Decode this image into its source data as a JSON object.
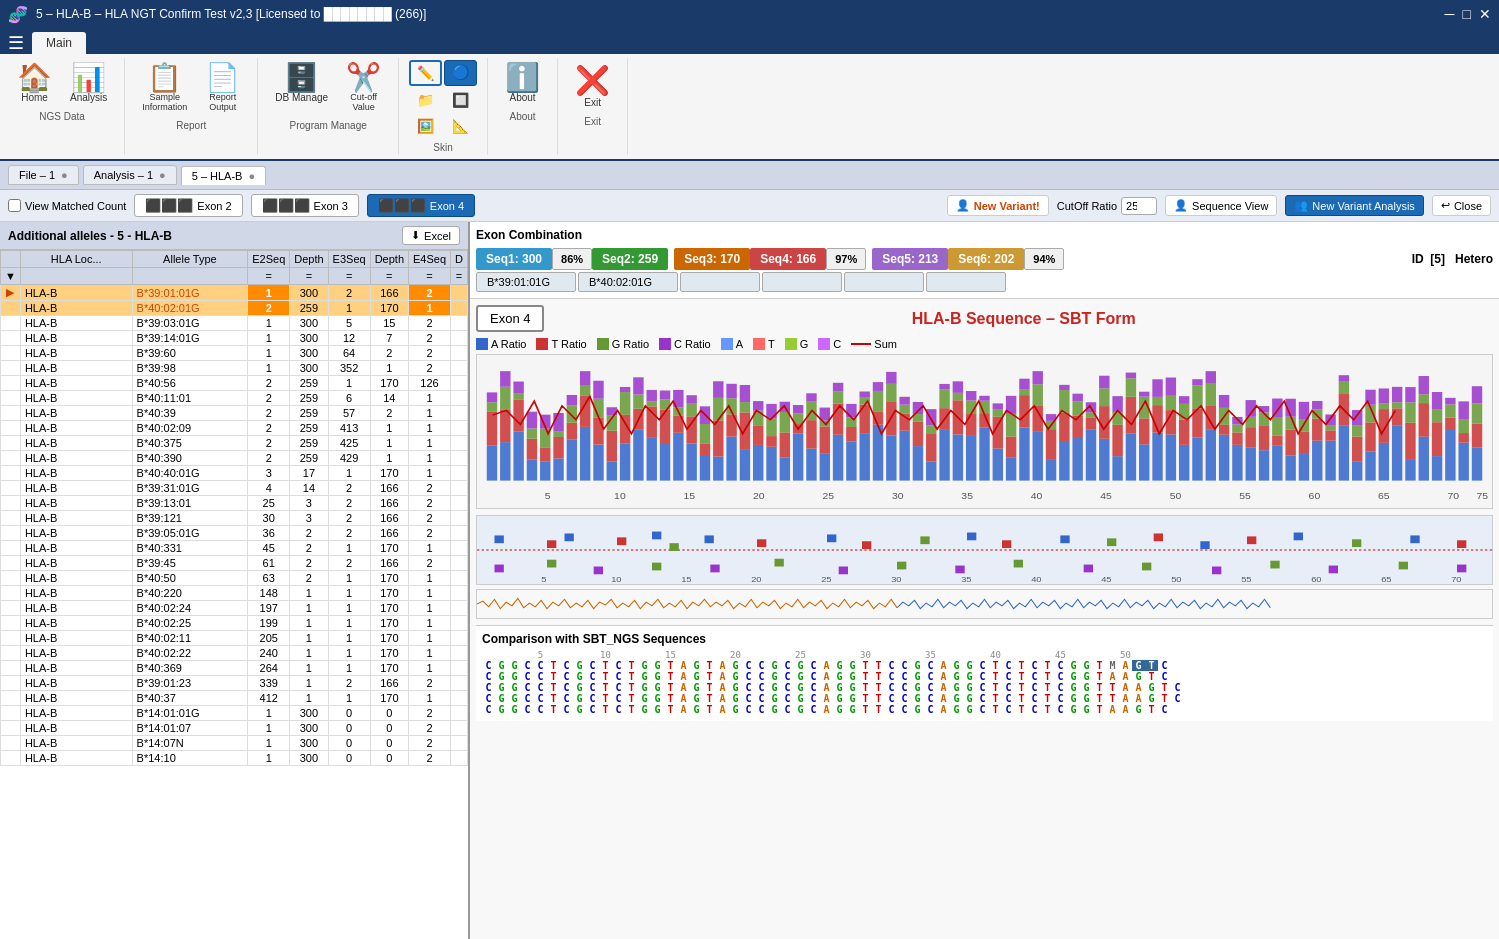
{
  "titleBar": {
    "title": "5 – HLA-B – HLA NGT Confirm Test v2,3  [Licensed to ████████ (266)]",
    "controls": [
      "minimize",
      "maximize",
      "close"
    ]
  },
  "ribbon": {
    "tabs": [
      "Main"
    ],
    "activeTab": "Main",
    "groups": [
      {
        "label": "NGS Data",
        "buttons": [
          {
            "icon": "🏠",
            "label": "Home"
          },
          {
            "icon": "📊",
            "label": "Analysis"
          }
        ]
      },
      {
        "label": "Report",
        "buttons": [
          {
            "icon": "📋",
            "label": "Sample\nInformation"
          },
          {
            "icon": "📄",
            "label": "Report\nOutput"
          }
        ]
      },
      {
        "label": "Program Manage",
        "buttons": [
          {
            "icon": "🗄️",
            "label": "DB Manage"
          },
          {
            "icon": "✂️",
            "label": "Cut-off\nValue"
          }
        ]
      },
      {
        "label": "Skin",
        "buttons": [
          {
            "icon": "🎨",
            "label": ""
          },
          {
            "icon": "🔵",
            "label": ""
          },
          {
            "icon": "📁",
            "label": ""
          },
          {
            "icon": "🔲",
            "label": ""
          }
        ]
      },
      {
        "label": "About",
        "buttons": [
          {
            "icon": "ℹ️",
            "label": "About"
          }
        ]
      },
      {
        "label": "Exit",
        "buttons": [
          {
            "icon": "❌",
            "label": "Exit"
          }
        ]
      }
    ]
  },
  "docTabs": [
    {
      "label": "File – 1",
      "active": false
    },
    {
      "label": "Analysis – 1",
      "active": false
    },
    {
      "label": "5 – HLA-B",
      "active": true
    }
  ],
  "toolbar": {
    "viewMatchedCount": "View Matched Count",
    "exonTabs": [
      "Exon 2",
      "Exon 3",
      "Exon 4"
    ],
    "activeExon": "Exon 4",
    "newVariantLabel": "New Variant!",
    "cutOffRatioLabel": "CutOff Ratio",
    "cutOffValue": "25",
    "sequenceViewLabel": "Sequence View",
    "newVariantAnalysisLabel": "New Variant Analysis",
    "closeLabel": "Close"
  },
  "leftPanel": {
    "header": "Additional alleles - 5 - HLA-B",
    "excelBtn": "Excel",
    "columns": [
      "HLA Loc...",
      "Allele Type",
      "E2Seq",
      "Depth",
      "E3Seq",
      "Depth",
      "E4Seq",
      "D"
    ],
    "rows": [
      {
        "hlb": "HLA-B",
        "allele": "B*39:01:01G",
        "e2seq": "1",
        "e2dep": "300",
        "e3seq": "2",
        "e3dep": "166",
        "e4seq": "2",
        "d": "",
        "selected": true,
        "rank": "1"
      },
      {
        "hlb": "HLA-B",
        "allele": "B*40:02:01G",
        "e2seq": "2",
        "e2dep": "259",
        "e3seq": "1",
        "e3dep": "170",
        "e4seq": "1",
        "d": "",
        "selected": true,
        "rank": "2"
      },
      {
        "hlb": "HLA-B",
        "allele": "B*39:03:01G",
        "e2seq": "1",
        "e2dep": "300",
        "e3seq": "5",
        "e3dep": "15",
        "e4seq": "2",
        "d": ""
      },
      {
        "hlb": "HLA-B",
        "allele": "B*39:14:01G",
        "e2seq": "1",
        "e2dep": "300",
        "e3seq": "12",
        "e3dep": "7",
        "e4seq": "2",
        "d": ""
      },
      {
        "hlb": "HLA-B",
        "allele": "B*39:60",
        "e2seq": "1",
        "e2dep": "300",
        "e3seq": "64",
        "e3dep": "2",
        "e4seq": "2",
        "d": ""
      },
      {
        "hlb": "HLA-B",
        "allele": "B*39:98",
        "e2seq": "1",
        "e2dep": "300",
        "e3seq": "352",
        "e3dep": "1",
        "e4seq": "2",
        "d": ""
      },
      {
        "hlb": "HLA-B",
        "allele": "B*40:56",
        "e2seq": "2",
        "e2dep": "259",
        "e3seq": "1",
        "e3dep": "170",
        "e4seq": "126",
        "d": ""
      },
      {
        "hlb": "HLA-B",
        "allele": "B*40:11:01",
        "e2seq": "2",
        "e2dep": "259",
        "e3seq": "6",
        "e3dep": "14",
        "e4seq": "1",
        "d": ""
      },
      {
        "hlb": "HLA-B",
        "allele": "B*40:39",
        "e2seq": "2",
        "e2dep": "259",
        "e3seq": "57",
        "e3dep": "2",
        "e4seq": "1",
        "d": ""
      },
      {
        "hlb": "HLA-B",
        "allele": "B*40:02:09",
        "e2seq": "2",
        "e2dep": "259",
        "e3seq": "413",
        "e3dep": "1",
        "e4seq": "1",
        "d": ""
      },
      {
        "hlb": "HLA-B",
        "allele": "B*40:375",
        "e2seq": "2",
        "e2dep": "259",
        "e3seq": "425",
        "e3dep": "1",
        "e4seq": "1",
        "d": ""
      },
      {
        "hlb": "HLA-B",
        "allele": "B*40:390",
        "e2seq": "2",
        "e2dep": "259",
        "e3seq": "429",
        "e3dep": "1",
        "e4seq": "1",
        "d": ""
      },
      {
        "hlb": "HLA-B",
        "allele": "B*40:40:01G",
        "e2seq": "3",
        "e2dep": "17",
        "e3seq": "1",
        "e3dep": "170",
        "e4seq": "1",
        "d": ""
      },
      {
        "hlb": "HLA-B",
        "allele": "B*39:31:01G",
        "e2seq": "4",
        "e2dep": "14",
        "e3seq": "2",
        "e3dep": "166",
        "e4seq": "2",
        "d": ""
      },
      {
        "hlb": "HLA-B",
        "allele": "B*39:13:01",
        "e2seq": "25",
        "e2dep": "3",
        "e3seq": "2",
        "e3dep": "166",
        "e4seq": "2",
        "d": ""
      },
      {
        "hlb": "HLA-B",
        "allele": "B*39:121",
        "e2seq": "30",
        "e2dep": "3",
        "e3seq": "2",
        "e3dep": "166",
        "e4seq": "2",
        "d": ""
      },
      {
        "hlb": "HLA-B",
        "allele": "B*39:05:01G",
        "e2seq": "36",
        "e2dep": "2",
        "e3seq": "2",
        "e3dep": "166",
        "e4seq": "2",
        "d": ""
      },
      {
        "hlb": "HLA-B",
        "allele": "B*40:331",
        "e2seq": "45",
        "e2dep": "2",
        "e3seq": "1",
        "e3dep": "170",
        "e4seq": "1",
        "d": ""
      },
      {
        "hlb": "HLA-B",
        "allele": "B*39:45",
        "e2seq": "61",
        "e2dep": "2",
        "e3seq": "2",
        "e3dep": "166",
        "e4seq": "2",
        "d": ""
      },
      {
        "hlb": "HLA-B",
        "allele": "B*40:50",
        "e2seq": "63",
        "e2dep": "2",
        "e3seq": "1",
        "e3dep": "170",
        "e4seq": "1",
        "d": ""
      },
      {
        "hlb": "HLA-B",
        "allele": "B*40:220",
        "e2seq": "148",
        "e2dep": "1",
        "e3seq": "1",
        "e3dep": "170",
        "e4seq": "1",
        "d": ""
      },
      {
        "hlb": "HLA-B",
        "allele": "B*40:02:24",
        "e2seq": "197",
        "e2dep": "1",
        "e3seq": "1",
        "e3dep": "170",
        "e4seq": "1",
        "d": ""
      },
      {
        "hlb": "HLA-B",
        "allele": "B*40:02:25",
        "e2seq": "199",
        "e2dep": "1",
        "e3seq": "1",
        "e3dep": "170",
        "e4seq": "1",
        "d": ""
      },
      {
        "hlb": "HLA-B",
        "allele": "B*40:02:11",
        "e2seq": "205",
        "e2dep": "1",
        "e3seq": "1",
        "e3dep": "170",
        "e4seq": "1",
        "d": ""
      },
      {
        "hlb": "HLA-B",
        "allele": "B*40:02:22",
        "e2seq": "240",
        "e2dep": "1",
        "e3seq": "1",
        "e3dep": "170",
        "e4seq": "1",
        "d": ""
      },
      {
        "hlb": "HLA-B",
        "allele": "B*40:369",
        "e2seq": "264",
        "e2dep": "1",
        "e3seq": "1",
        "e3dep": "170",
        "e4seq": "1",
        "d": ""
      },
      {
        "hlb": "HLA-B",
        "allele": "B*39:01:23",
        "e2seq": "339",
        "e2dep": "1",
        "e3seq": "2",
        "e3dep": "166",
        "e4seq": "2",
        "d": ""
      },
      {
        "hlb": "HLA-B",
        "allele": "B*40:37",
        "e2seq": "412",
        "e2dep": "1",
        "e3seq": "1",
        "e3dep": "170",
        "e4seq": "1",
        "d": ""
      },
      {
        "hlb": "HLA-B",
        "allele": "B*14:01:01G",
        "e2seq": "1",
        "e2dep": "300",
        "e3seq": "0",
        "e3dep": "0",
        "e4seq": "2",
        "d": ""
      },
      {
        "hlb": "HLA-B",
        "allele": "B*14:01:07",
        "e2seq": "1",
        "e2dep": "300",
        "e3seq": "0",
        "e3dep": "0",
        "e4seq": "2",
        "d": ""
      },
      {
        "hlb": "HLA-B",
        "allele": "B*14:07N",
        "e2seq": "1",
        "e2dep": "300",
        "e3seq": "0",
        "e3dep": "0",
        "e4seq": "2",
        "d": ""
      },
      {
        "hlb": "HLA-B",
        "allele": "B*14:10",
        "e2seq": "1",
        "e2dep": "300",
        "e3seq": "0",
        "e3dep": "0",
        "e4seq": "2",
        "d": ""
      }
    ]
  },
  "exonCombo": {
    "title": "Exon Combination",
    "seqs": [
      {
        "label": "Seq1: 300",
        "color": "#3399cc"
      },
      {
        "pct": "86%"
      },
      {
        "label": "Seq2: 259",
        "color": "#339933"
      },
      {
        "label": "Seq3: 170",
        "color": "#cc6600"
      },
      {
        "label": "Seq4: 166",
        "color": "#cc4444"
      },
      {
        "pct": "97%"
      },
      {
        "label": "Seq5: 213",
        "color": "#9966cc"
      },
      {
        "label": "Seq6: 202",
        "color": "#cc9933"
      },
      {
        "pct": "94%"
      }
    ],
    "alleles": [
      "B*39:01:01G",
      "B*40:02:01G"
    ],
    "id": "5",
    "hetero": "Hetero"
  },
  "chart": {
    "title": "HLA-B Sequence – SBT Form",
    "exonLabel": "Exon 4",
    "legend": [
      {
        "label": "A Ratio",
        "color": "#3366cc"
      },
      {
        "label": "T Ratio",
        "color": "#cc3333"
      },
      {
        "label": "G Ratio",
        "color": "#669933"
      },
      {
        "label": "C Ratio",
        "color": "#9933cc"
      },
      {
        "label": "A",
        "color": "#6699ff"
      },
      {
        "label": "T",
        "color": "#ff6666"
      },
      {
        "label": "G",
        "color": "#99cc33"
      },
      {
        "label": "C",
        "color": "#cc66ff"
      },
      {
        "label": "Sum",
        "color": "#cc0000",
        "line": true
      }
    ],
    "xLabels": [
      5,
      10,
      15,
      20,
      25,
      30,
      35,
      40,
      45,
      50,
      55,
      60,
      65,
      70,
      75
    ]
  },
  "comparison": {
    "title": "Comparison with SBT_NGS Sequences",
    "sequence": "CGGCCTCGCTCTGGTAGTAGCCGCGCAGGTTCCGCAGGCTCTCTCGGTMAGTC",
    "positions": "1 2 3 4 5 6 7 8 9 10 11 12 13 14 15 16 17 18 19 20 21 22 23 24 25 26 27 28 29 30 31 32 33 34 35 36 37 38 39 40 41 42 43 44 45 46 47 48 49 50 51 52 53 54 55 56",
    "rows": [
      "CGGCCTCGCTCTGGTAGTAGCCGCGCAGGTTCCGCAGGCTCTCTCGGTMAGTC",
      "CGGCCTCGCTCTGGTAGT AGCCGCGCAGGTTCCGCAGGCTCTCTCGGTAAGTC",
      "CGGCCTCGCTCTGGTAGTAGCCGCGCAGGTTCCGCAGGCTCTCTCGGTTAAGTC",
      "CGGCCTCGCTCTGGTAGTAGCCGCGCAGGTTCCGCAGGCTCTCTCGGTTAAGTC",
      "CGGCCTCGCTCTGGTAGTAGCCGCGCAGGTTCCGCAGGCTCTCTCGGTAAGTC"
    ]
  },
  "colors": {
    "seq1": "#3399cc",
    "seq2": "#339933",
    "seq3": "#cc6600",
    "seq4": "#cc4444",
    "seq5": "#9966cc",
    "seq6": "#cc9933",
    "selectedRow": "#ffd080",
    "activeExon": "#1a6ab5",
    "newVariant": "#cc4400",
    "headerBg": "#1a3a6a"
  }
}
